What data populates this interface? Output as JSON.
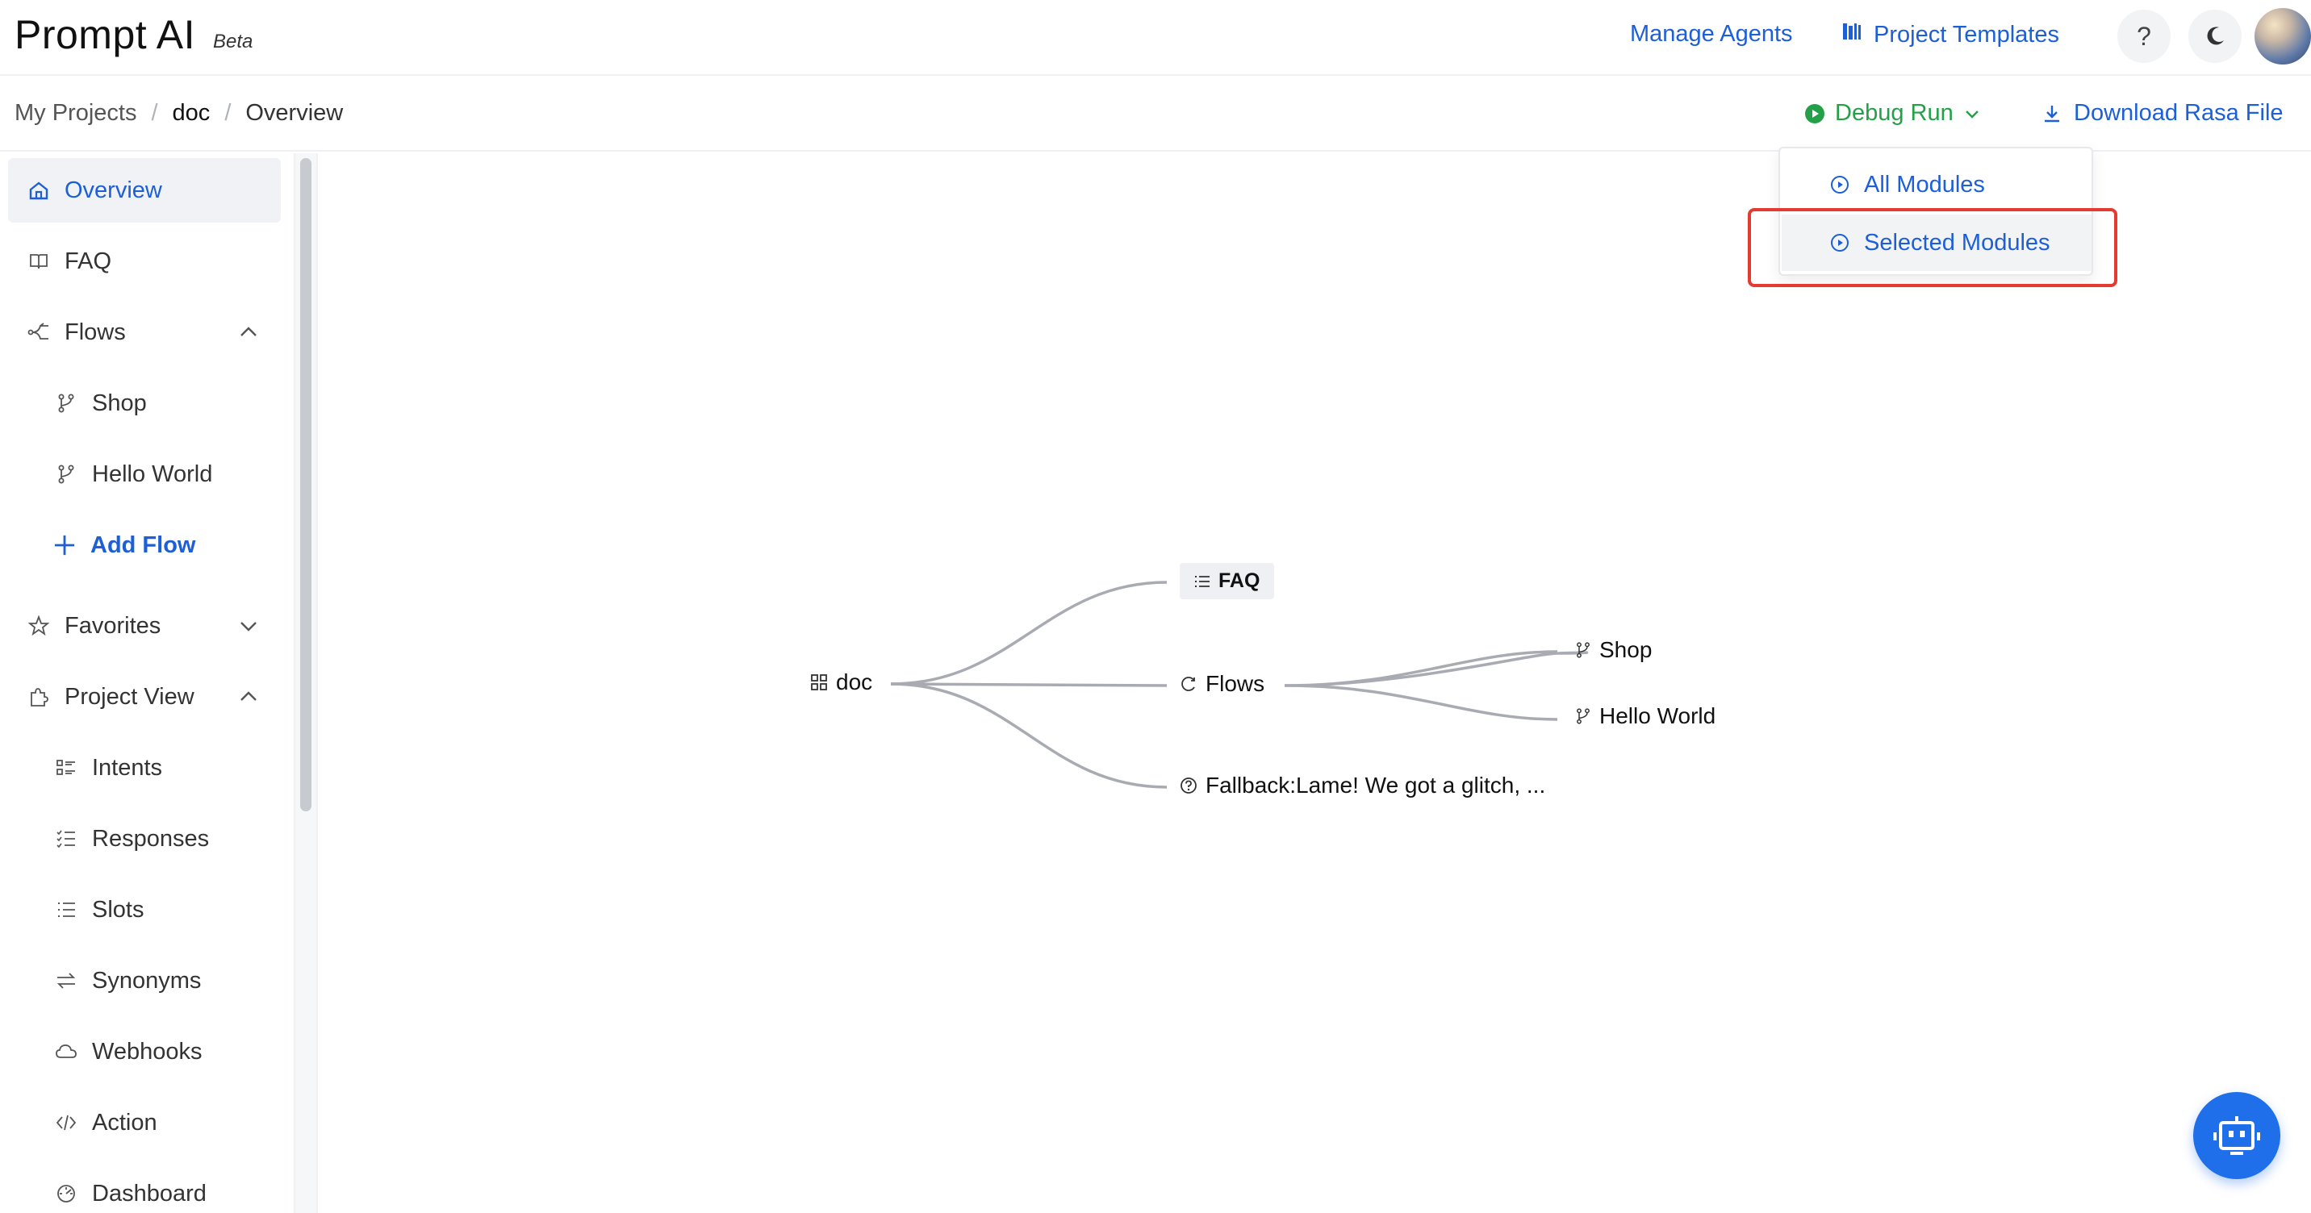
{
  "header": {
    "app_name": "Prompt AI",
    "app_tag": "Beta",
    "manage_agents": "Manage Agents",
    "project_templates": "Project Templates",
    "help_glyph": "?"
  },
  "breadcrumb": {
    "root": "My Projects",
    "project": "doc",
    "current": "Overview",
    "separator": "/"
  },
  "toolbar": {
    "debug_run": "Debug Run",
    "download": "Download Rasa File"
  },
  "dropdown": {
    "items": [
      {
        "label": "All Modules"
      },
      {
        "label": "Selected Modules"
      }
    ]
  },
  "sidebar": {
    "items": [
      {
        "label": "Overview",
        "icon": "home-icon"
      },
      {
        "label": "FAQ",
        "icon": "book-icon"
      },
      {
        "label": "Flows",
        "icon": "flow-icon"
      },
      {
        "label": "Shop",
        "icon": "branch-icon"
      },
      {
        "label": "Hello World",
        "icon": "branch-icon"
      },
      {
        "label": "Add Flow",
        "icon": "plus-icon"
      },
      {
        "label": "Favorites",
        "icon": "star-icon"
      },
      {
        "label": "Project View",
        "icon": "puzzle-icon"
      },
      {
        "label": "Intents",
        "icon": "intents-icon"
      },
      {
        "label": "Responses",
        "icon": "responses-icon"
      },
      {
        "label": "Slots",
        "icon": "slots-icon"
      },
      {
        "label": "Synonyms",
        "icon": "swap-icon"
      },
      {
        "label": "Webhooks",
        "icon": "cloud-icon"
      },
      {
        "label": "Action",
        "icon": "code-icon"
      },
      {
        "label": "Dashboard",
        "icon": "dashboard-icon"
      }
    ]
  },
  "mindmap": {
    "root": "doc",
    "branches": {
      "faq": "FAQ",
      "flows": "Flows",
      "fallback": "Fallback:Lame! We got a glitch, ..."
    },
    "flows_children": [
      "Shop",
      "Hello World"
    ]
  },
  "colors": {
    "accent": "#1d5fd6",
    "success": "#24a148",
    "highlight": "#e53a2f",
    "bot": "#1f6feb"
  }
}
